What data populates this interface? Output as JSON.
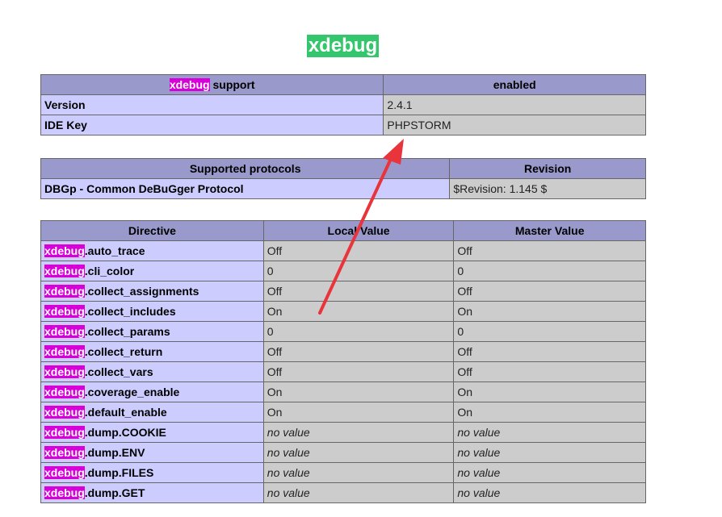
{
  "title": "xdebug",
  "support_table": {
    "header": {
      "left_highlight": "xdebug",
      "left_rest": " support",
      "right": "enabled"
    },
    "rows": [
      {
        "key": "Version",
        "value": "2.4.1"
      },
      {
        "key": "IDE Key",
        "value": "PHPSTORM"
      }
    ]
  },
  "protocols_table": {
    "headers": [
      "Supported protocols",
      "Revision"
    ],
    "rows": [
      {
        "key": "DBGp - Common DeBuGger Protocol",
        "value": "$Revision: 1.145 $"
      }
    ]
  },
  "directives_table": {
    "headers": [
      "Directive",
      "Local Value",
      "Master Value"
    ],
    "prefix": "xdebug",
    "rows": [
      {
        "name": ".auto_trace",
        "local": "Off",
        "master": "Off"
      },
      {
        "name": ".cli_color",
        "local": "0",
        "master": "0"
      },
      {
        "name": ".collect_assignments",
        "local": "Off",
        "master": "Off"
      },
      {
        "name": ".collect_includes",
        "local": "On",
        "master": "On"
      },
      {
        "name": ".collect_params",
        "local": "0",
        "master": "0"
      },
      {
        "name": ".collect_return",
        "local": "Off",
        "master": "Off"
      },
      {
        "name": ".collect_vars",
        "local": "Off",
        "master": "Off"
      },
      {
        "name": ".coverage_enable",
        "local": "On",
        "master": "On"
      },
      {
        "name": ".default_enable",
        "local": "On",
        "master": "On"
      },
      {
        "name": ".dump.COOKIE",
        "local": "no value",
        "master": "no value"
      },
      {
        "name": ".dump.ENV",
        "local": "no value",
        "master": "no value"
      },
      {
        "name": ".dump.FILES",
        "local": "no value",
        "master": "no value"
      },
      {
        "name": ".dump.GET",
        "local": "no value",
        "master": "no value"
      }
    ]
  },
  "annotation": {
    "arrow_color": "#e8343a"
  }
}
